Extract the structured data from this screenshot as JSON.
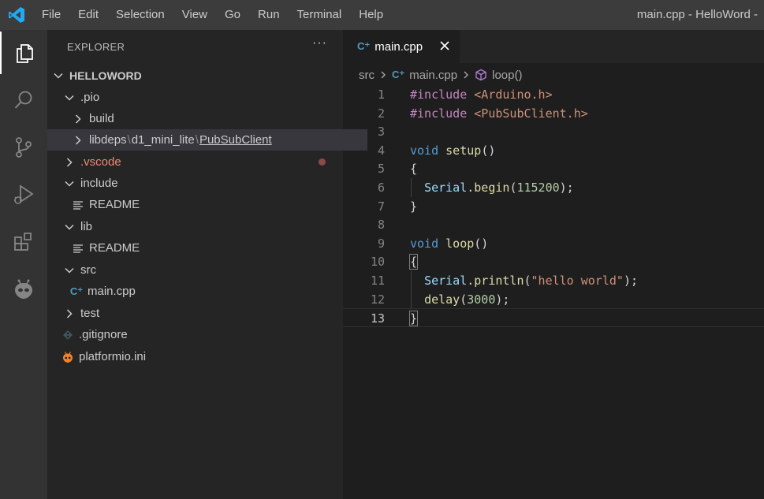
{
  "menu": [
    "File",
    "Edit",
    "Selection",
    "View",
    "Go",
    "Run",
    "Terminal",
    "Help"
  ],
  "window_title": "main.cpp - HelloWord -",
  "explorer": {
    "header": "EXPLORER",
    "more": "···",
    "project": "HELLOWORD",
    "tree": [
      {
        "label": ".pio",
        "type": "folder",
        "open": true,
        "depth": 1
      },
      {
        "label": "build",
        "type": "folder",
        "open": false,
        "depth": 2
      },
      {
        "label_parts": [
          "libdeps",
          "d1_mini_lite",
          "PubSubClient"
        ],
        "separator": "\\",
        "type": "folder",
        "open": false,
        "depth": 2,
        "selected": true
      },
      {
        "label": ".vscode",
        "type": "folder",
        "open": false,
        "depth": 1,
        "color": "#f48771",
        "modified": true
      },
      {
        "label": "include",
        "type": "folder",
        "open": true,
        "depth": 1
      },
      {
        "label": "README",
        "type": "file",
        "icon": "lines-icon",
        "depth": 2
      },
      {
        "label": "lib",
        "type": "folder",
        "open": true,
        "depth": 1
      },
      {
        "label": "README",
        "type": "file",
        "icon": "lines-icon",
        "depth": 2
      },
      {
        "label": "src",
        "type": "folder",
        "open": true,
        "depth": 1
      },
      {
        "label": "main.cpp",
        "type": "file",
        "icon": "cpp-icon",
        "depth": 2
      },
      {
        "label": "test",
        "type": "folder",
        "open": false,
        "depth": 1
      },
      {
        "label": ".gitignore",
        "type": "file",
        "icon": "git-icon",
        "depth": 1
      },
      {
        "label": "platformio.ini",
        "type": "file",
        "icon": "platformio-icon",
        "depth": 1
      }
    ]
  },
  "tab": {
    "label": "main.cpp"
  },
  "breadcrumbs": {
    "folder": "src",
    "file": "main.cpp",
    "symbol": "loop()"
  },
  "code_lines": [
    {
      "n": "1",
      "tokens": [
        [
          "pp",
          "#include "
        ],
        [
          "str",
          "<Arduino.h>"
        ]
      ]
    },
    {
      "n": "2",
      "tokens": [
        [
          "pp",
          "#include "
        ],
        [
          "str",
          "<PubSubClient.h>"
        ]
      ]
    },
    {
      "n": "3",
      "tokens": []
    },
    {
      "n": "4",
      "tokens": [
        [
          "kw",
          "void "
        ],
        [
          "fn",
          "setup"
        ],
        [
          "punc",
          "()"
        ]
      ]
    },
    {
      "n": "5",
      "tokens": [
        [
          "punc",
          "{"
        ]
      ]
    },
    {
      "n": "6",
      "tokens": [
        [
          "punc",
          "  "
        ],
        [
          "var",
          "Serial"
        ],
        [
          "punc",
          "."
        ],
        [
          "fn",
          "begin"
        ],
        [
          "punc",
          "("
        ],
        [
          "num",
          "115200"
        ],
        [
          "punc",
          ");"
        ]
      ]
    },
    {
      "n": "7",
      "tokens": [
        [
          "punc",
          "}"
        ]
      ]
    },
    {
      "n": "8",
      "tokens": []
    },
    {
      "n": "9",
      "tokens": [
        [
          "kw",
          "void "
        ],
        [
          "fn",
          "loop"
        ],
        [
          "punc",
          "()"
        ]
      ]
    },
    {
      "n": "10",
      "tokens": [
        [
          "punc",
          "{"
        ]
      ]
    },
    {
      "n": "11",
      "tokens": [
        [
          "punc",
          "  "
        ],
        [
          "var",
          "Serial"
        ],
        [
          "punc",
          "."
        ],
        [
          "fn",
          "println"
        ],
        [
          "punc",
          "("
        ],
        [
          "str",
          "\"hello world\""
        ],
        [
          "punc",
          ");"
        ]
      ]
    },
    {
      "n": "12",
      "tokens": [
        [
          "punc",
          "  "
        ],
        [
          "fn",
          "delay"
        ],
        [
          "punc",
          "("
        ],
        [
          "num",
          "3000"
        ],
        [
          "punc",
          ");"
        ]
      ]
    },
    {
      "n": "13",
      "tokens": [
        [
          "punc",
          "}"
        ]
      ]
    }
  ],
  "current_line": "13",
  "colors": {
    "accent": "#0078d4",
    "modified": "#f48771",
    "cpp_icon": "#519aba",
    "platformio_icon": "#f5822a"
  }
}
